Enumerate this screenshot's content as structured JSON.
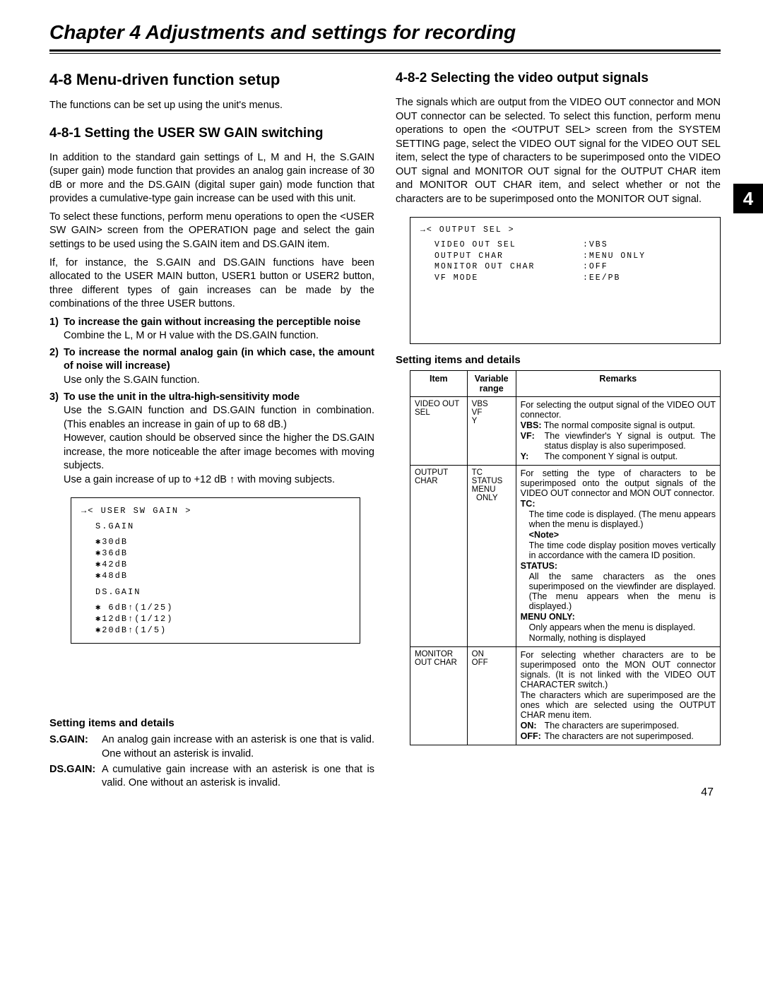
{
  "chapter_title": "Chapter 4  Adjustments and settings for recording",
  "tab_number": "4",
  "page_number": "47",
  "left": {
    "h_4_8": "4-8 Menu-driven function setup",
    "p1": "The functions can be set up using the unit's menus.",
    "h_4_8_1": "4-8-1 Setting the USER SW GAIN switching",
    "p2": "In addition to the standard gain settings of L, M and H, the S.GAIN (super gain) mode function that provides an analog gain increase of 30 dB or more and the DS.GAIN (digital super gain) mode function that provides a cumulative-type gain increase can be used with this unit.",
    "p3": "To select these functions, perform menu operations to open the <USER SW GAIN> screen from the OPERATION page and select the gain settings to be used using the S.GAIN item and DS.GAIN item.",
    "p4": "If, for instance, the S.GAIN and DS.GAIN functions have been allocated to the USER MAIN button, USER1 button or USER2 button, three different types of gain increases can be made by the combinations of the three USER buttons.",
    "li1_head": "To increase the gain without increasing the perceptible noise",
    "li1_body": "Combine the L, M or H value with the DS.GAIN function.",
    "li2_head": "To increase the normal analog gain (in which case, the amount of noise will increase)",
    "li2_body": "Use only the S.GAIN function.",
    "li3_head": "To use the unit in the ultra-high-sensitivity mode",
    "li3_b1": "Use the S.GAIN function and DS.GAIN function in combination.  (This enables an increase in gain of up to 68 dB.)",
    "li3_b2": "However, caution should be observed since the higher the DS.GAIN increase, the more noticeable the after image becomes with moving subjects.",
    "li3_b3_a": "Use a gain increase of up to +12 dB ",
    "li3_b3_b": " with moving subjects.",
    "menu1_title": "→<  USER SW GAIN  >",
    "menu1_l1": "S.GAIN",
    "menu1_l2": "✱30dB",
    "menu1_l3": "✱36dB",
    "menu1_l4": "✱42dB",
    "menu1_l5": "✱48dB",
    "menu1_l6": "DS.GAIN",
    "menu1_l7": "✱ 6dB↑(1/25)",
    "menu1_l8": "✱12dB↑(1/12)",
    "menu1_l9": "✱20dB↑(1/5)",
    "setting_head": "Setting items and details",
    "sg_term": "S.GAIN:",
    "sg_def": "An analog gain increase with an asterisk is one that is valid.  One without an asterisk is invalid.",
    "ds_term": "DS.GAIN:",
    "ds_def": "A cumulative gain increase with an asterisk is one that is valid.  One without an asterisk is invalid."
  },
  "right": {
    "h_4_8_2": "4-8-2 Selecting the video output signals",
    "p1": "The signals which are output from the VIDEO OUT connector and MON OUT connector can be selected.  To select this function, perform menu operations to open the <OUTPUT SEL> screen from the SYSTEM SETTING page, select the VIDEO OUT signal for the VIDEO OUT SEL item, select the type of characters to be superimposed onto the VIDEO OUT signal and MONITOR OUT signal for the OUTPUT CHAR item and MONITOR OUT CHAR item, and select whether or not the characters are to be superimposed onto the MONITOR OUT signal.",
    "menu2_title": "→<  OUTPUT SEL  >",
    "menu2_r1k": "VIDEO OUT SEL",
    "menu2_r1v": ":VBS",
    "menu2_r2k": "OUTPUT CHAR",
    "menu2_r2v": ":MENU ONLY",
    "menu2_r3k": "MONITOR OUT CHAR",
    "menu2_r3v": ":OFF",
    "menu2_r4k": "VF MODE",
    "menu2_r4v": ":EE/PB",
    "setting_head": "Setting items and details",
    "th_item": "Item",
    "th_var": "Variable range",
    "th_rem": "Remarks",
    "row1_item": "VIDEO OUT SEL",
    "row1_var": "VBS\nVF\nY",
    "row1_rem1": "For selecting the output signal of the VIDEO OUT connector.",
    "row1_vbs": "VBS:",
    "row1_vbs_t": "The normal composite signal is output.",
    "row1_vf": "VF:",
    "row1_vf_t": "The viewfinder's Y signal is output.  The status display is also superimposed.",
    "row1_y": "Y:",
    "row1_y_t": "The component Y signal is output.",
    "row2_item": "OUTPUT CHAR",
    "row2_var": "TC\nSTATUS\nMENU\n  ONLY",
    "row2_rem1": "For setting the type of characters to be superimposed onto the output signals of the VIDEO OUT connector and MON OUT connector.",
    "row2_tc": "TC:",
    "row2_tc_t1": "The time code is displayed.  (The menu appears when the menu is displayed.)",
    "row2_note": "<Note>",
    "row2_tc_t2": "The time code display position moves vertically in accordance with the camera ID position.",
    "row2_st": "STATUS:",
    "row2_st_t": "All the same characters as the ones superimposed on the viewfinder are displayed.  (The menu appears when the menu is displayed.)",
    "row2_mo": "MENU ONLY:",
    "row2_mo_t1": "Only appears when the menu is displayed.",
    "row2_mo_t2": "Normally, nothing is displayed",
    "row3_item": "MONITOR OUT CHAR",
    "row3_var": "ON\nOFF",
    "row3_rem1": "For selecting whether characters are to be superimposed onto the MON OUT connector signals.  (It is not linked with the VIDEO OUT CHARACTER switch.)",
    "row3_rem2": "The characters which are superimposed are the ones which are selected using the OUTPUT CHAR menu item.",
    "row3_on": "ON:",
    "row3_on_t": "The characters are superimposed.",
    "row3_off": "OFF:",
    "row3_off_t": "The characters are not superimposed."
  }
}
